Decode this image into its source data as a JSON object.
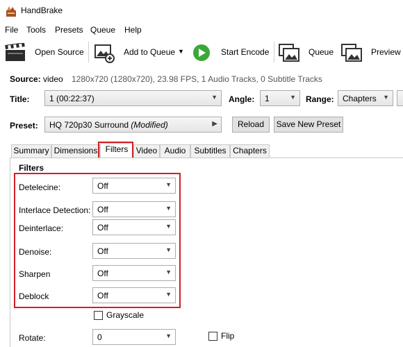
{
  "window": {
    "title": "HandBrake"
  },
  "menu": [
    "File",
    "Tools",
    "Presets",
    "Queue",
    "Help"
  ],
  "toolbar": {
    "open_source": "Open Source",
    "add_to_queue": "Add to Queue",
    "start_encode": "Start Encode",
    "queue": "Queue",
    "preview": "Preview"
  },
  "source": {
    "label": "Source:",
    "name": "video",
    "info": "1280x720 (1280x720), 23.98 FPS, 1 Audio Tracks, 0 Subtitle Tracks"
  },
  "title": {
    "label": "Title:",
    "value": "1  (00:22:37)"
  },
  "angle": {
    "label": "Angle:",
    "value": "1"
  },
  "range": {
    "label": "Range:",
    "value": "Chapters"
  },
  "preset": {
    "label": "Preset:",
    "name": "HQ 720p30 Surround",
    "modified": "(Modified)",
    "reload": "Reload",
    "save_new": "Save New Preset"
  },
  "tabs": [
    "Summary",
    "Dimensions",
    "Filters",
    "Video",
    "Audio",
    "Subtitles",
    "Chapters"
  ],
  "active_tab": "Filters",
  "filters": {
    "heading": "Filters",
    "detelecine": {
      "label": "Detelecine:",
      "value": "Off"
    },
    "interlace_detection": {
      "label": "Interlace Detection:",
      "value": "Off"
    },
    "deinterlace": {
      "label": "Deinterlace:",
      "value": "Off"
    },
    "denoise": {
      "label": "Denoise:",
      "value": "Off"
    },
    "sharpen": {
      "label": "Sharpen",
      "value": "Off"
    },
    "deblock": {
      "label": "Deblock",
      "value": "Off"
    },
    "grayscale": {
      "label": "Grayscale",
      "checked": false
    },
    "rotate": {
      "label": "Rotate:",
      "value": "0"
    },
    "flip": {
      "label": "Flip",
      "checked": false
    }
  },
  "colors": {
    "highlight": "#d21f26",
    "play_green": "#3aa837"
  }
}
